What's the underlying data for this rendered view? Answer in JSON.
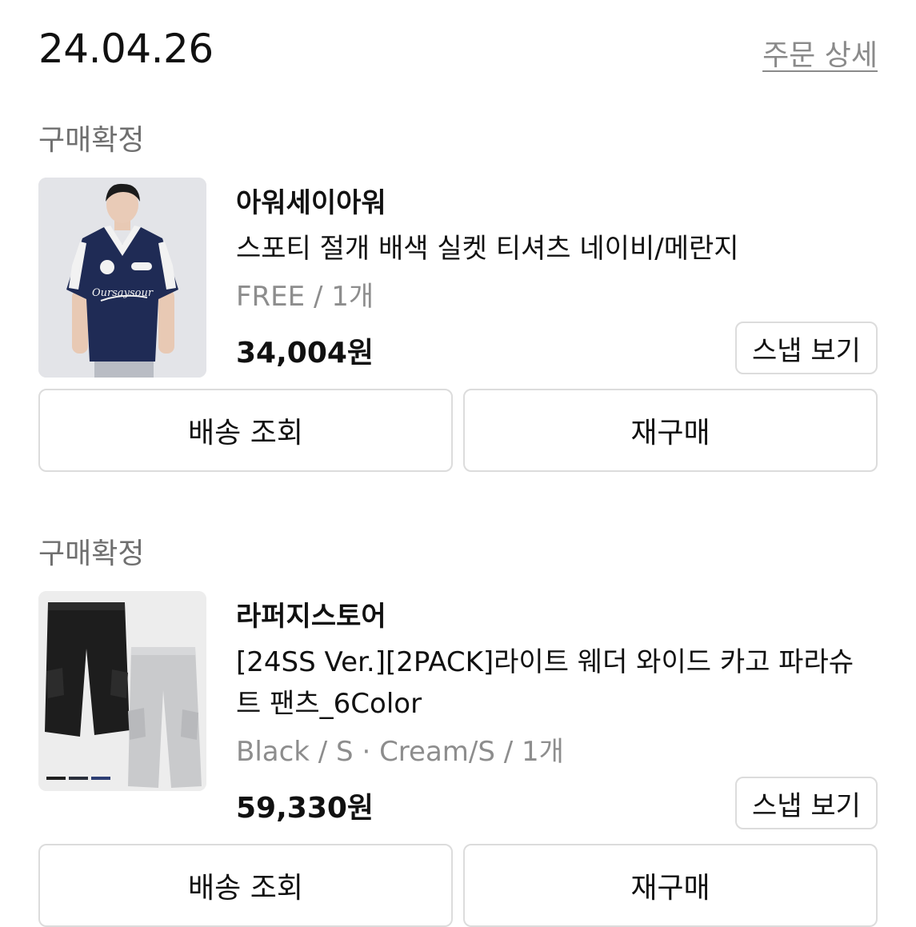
{
  "header": {
    "date": "24.04.26",
    "detail_link": "주문 상세"
  },
  "orders": [
    {
      "status": "구매확정",
      "brand": "아워세이아워",
      "product_name": "스포티 절개 배색 실켓 티셔츠 네이비/메란지",
      "options": "FREE / 1개",
      "price": "34,004원",
      "snap_label": "스냅 보기",
      "track_label": "배송 조회",
      "rebuy_label": "재구매",
      "image_caption": "Oursaysour"
    },
    {
      "status": "구매확정",
      "brand": "라퍼지스토어",
      "product_name": "[24SS Ver.][2PACK]라이트 웨더 와이드 카고 파라슈트 팬츠_6Color",
      "options": "Black / S · Cream/S / 1개",
      "price": "59,330원",
      "snap_label": "스냅 보기",
      "track_label": "배송 조회",
      "rebuy_label": "재구매"
    }
  ]
}
